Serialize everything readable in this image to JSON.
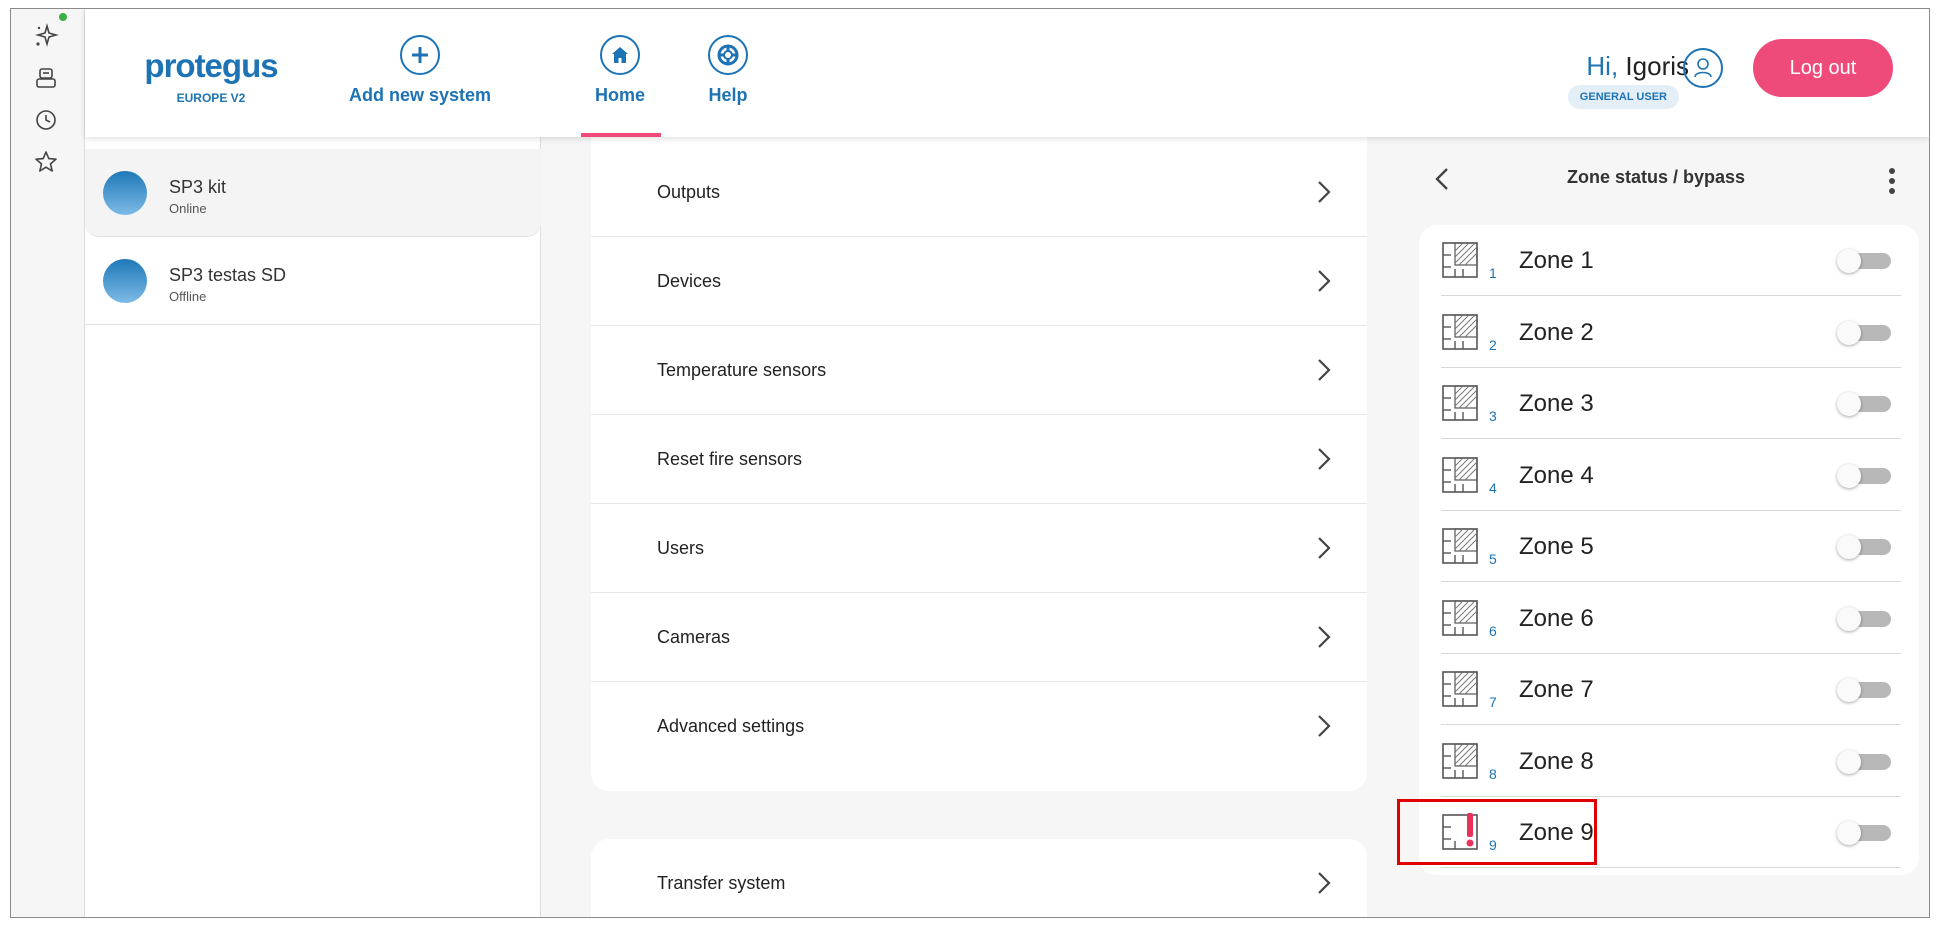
{
  "header": {
    "logo_text": "protegus",
    "logo_sub": "EUROPE V2",
    "add_system_label": "Add new system",
    "home_label": "Home",
    "help_label": "Help",
    "greeting_hi": "Hi,",
    "user_name": "Igoris",
    "user_role": "GENERAL USER",
    "logout_label": "Log out"
  },
  "systems": [
    {
      "name": "SP3 kit",
      "status": "Online"
    },
    {
      "name": "SP3 testas SD",
      "status": "Offline"
    }
  ],
  "menu": {
    "items": [
      {
        "label": "Outputs"
      },
      {
        "label": "Devices"
      },
      {
        "label": "Temperature sensors"
      },
      {
        "label": "Reset fire sensors"
      },
      {
        "label": "Users"
      },
      {
        "label": "Cameras"
      },
      {
        "label": "Advanced settings"
      }
    ],
    "transfer_label": "Transfer system"
  },
  "zone_panel": {
    "title": "Zone status / bypass",
    "zones": [
      {
        "number": "1",
        "name": "Zone 1",
        "alarm": false,
        "bypassed": false
      },
      {
        "number": "2",
        "name": "Zone 2",
        "alarm": false,
        "bypassed": false
      },
      {
        "number": "3",
        "name": "Zone 3",
        "alarm": false,
        "bypassed": false
      },
      {
        "number": "4",
        "name": "Zone 4",
        "alarm": false,
        "bypassed": false
      },
      {
        "number": "5",
        "name": "Zone 5",
        "alarm": false,
        "bypassed": false
      },
      {
        "number": "6",
        "name": "Zone 6",
        "alarm": false,
        "bypassed": false
      },
      {
        "number": "7",
        "name": "Zone 7",
        "alarm": false,
        "bypassed": false
      },
      {
        "number": "8",
        "name": "Zone 8",
        "alarm": false,
        "bypassed": false
      },
      {
        "number": "9",
        "name": "Zone 9",
        "alarm": true,
        "bypassed": false
      }
    ]
  },
  "icons": {
    "rail": [
      "sparkle-icon",
      "robot-icon",
      "history-icon",
      "star-icon"
    ],
    "zone_normal": "zone-icon",
    "zone_alarm": "zone-alarm-icon"
  },
  "colors": {
    "brand_blue": "#1d73b3",
    "accent_pink": "#ee4a7a",
    "alarm_red": "#e8325c",
    "highlight_red": "#e00000",
    "online_dot": "#3cb043"
  }
}
